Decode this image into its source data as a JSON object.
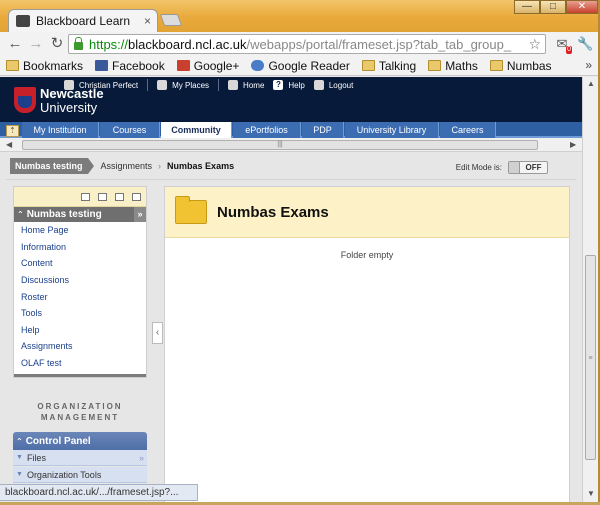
{
  "browser": {
    "tab_title": "Blackboard Learn",
    "url_scheme": "https://",
    "url_host": "blackboard.ncl.ac.uk",
    "url_path": "/webapps/portal/frameset.jsp?tab_tab_group_",
    "extension_badge": "0",
    "bookmarks": [
      {
        "label": "Bookmarks",
        "icon": "folder-icon"
      },
      {
        "label": "Facebook",
        "icon": "facebook-icon"
      },
      {
        "label": "Google+",
        "icon": "google-plus-icon"
      },
      {
        "label": "Google Reader",
        "icon": "google-reader-icon"
      },
      {
        "label": "Talking",
        "icon": "folder-icon"
      },
      {
        "label": "Maths",
        "icon": "folder-icon"
      },
      {
        "label": "Numbas",
        "icon": "folder-icon"
      }
    ],
    "status_url": "blackboard.ncl.ac.uk/.../frameset.jsp?..."
  },
  "header": {
    "logo_line1": "Newcastle",
    "logo_line2": "University",
    "user_name": "Christian Perfect",
    "links": [
      "My Places",
      "Home",
      "Help",
      "Logout"
    ]
  },
  "tabs": [
    "My Institution",
    "Courses",
    "Community",
    "ePortfolios",
    "PDP",
    "University Library",
    "Careers"
  ],
  "active_tab": "Community",
  "breadcrumb": {
    "course": "Numbas testing",
    "items": [
      "Assignments",
      "Numbas Exams"
    ]
  },
  "edit_mode": {
    "label": "Edit Mode is:",
    "state": "OFF"
  },
  "course_menu": {
    "title": "Numbas testing",
    "items": [
      "Home Page",
      "Information",
      "Content",
      "Discussions",
      "Roster",
      "Tools",
      "Help",
      "Assignments",
      "OLAF test"
    ]
  },
  "org_management": {
    "line1": "ORGANIZATION",
    "line2": "MANAGEMENT"
  },
  "control_panel": {
    "title": "Control Panel",
    "items": [
      "Files",
      "Organization Tools"
    ]
  },
  "main": {
    "title": "Numbas Exams",
    "empty_text": "Folder empty"
  },
  "colors": {
    "header_bg": "#071a3a",
    "tab_bar": "#2f5fa3",
    "page_header_bg": "#fdf1c7",
    "link": "#1a3f8c"
  }
}
